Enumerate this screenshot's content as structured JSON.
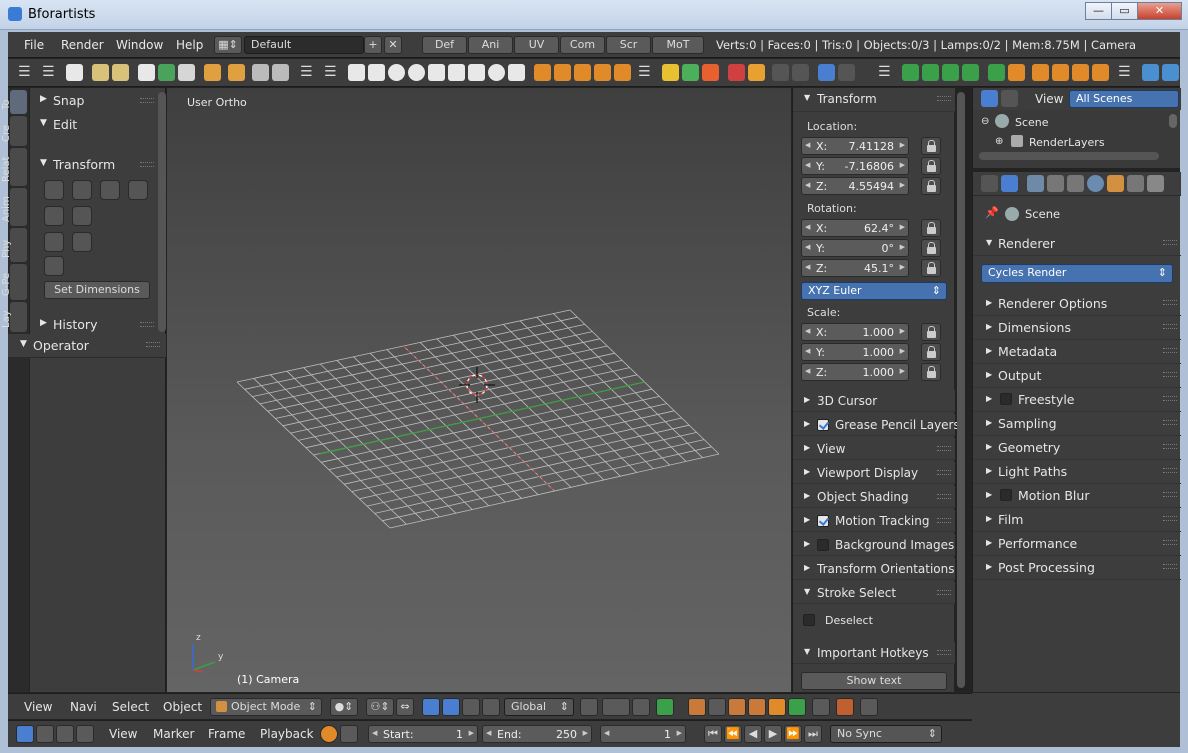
{
  "window": {
    "title": "Bforartists",
    "buttons": [
      "—",
      "▭",
      "✕"
    ]
  },
  "info": {
    "menus": [
      "File",
      "Render",
      "Window",
      "Help"
    ],
    "layout": "Default",
    "screens": [
      "Def",
      "Ani",
      "UV",
      "Com",
      "Scr",
      "MoT"
    ],
    "status": "Verts:0 | Faces:0 | Tris:0 | Objects:0/3 | Lamps:0/2 | Mem:8.75M | Camera"
  },
  "toolshelf": {
    "tabs": [
      "To",
      "Cre",
      "Relat",
      "Anim",
      "Phy",
      "G-Pe",
      "Lay"
    ],
    "panels": {
      "snap": "Snap",
      "edit": "Edit",
      "transform": "Transform",
      "history": "History",
      "operator": "Operator"
    },
    "set_dimensions": "Set Dimensions"
  },
  "viewport": {
    "label": "User Ortho",
    "object": "(1) Camera",
    "axis_x": "y",
    "axis_z": "z"
  },
  "npanel": {
    "transform": "Transform",
    "location_label": "Location:",
    "location": [
      {
        "axis": "X:",
        "value": "7.41128"
      },
      {
        "axis": "Y:",
        "value": "-7.16806"
      },
      {
        "axis": "Z:",
        "value": "4.55494"
      }
    ],
    "rotation_label": "Rotation:",
    "rotation": [
      {
        "axis": "X:",
        "value": "62.4°"
      },
      {
        "axis": "Y:",
        "value": "0°"
      },
      {
        "axis": "Z:",
        "value": "45.1°"
      }
    ],
    "rotation_mode": "XYZ Euler",
    "scale_label": "Scale:",
    "scale": [
      {
        "axis": "X:",
        "value": "1.000"
      },
      {
        "axis": "Y:",
        "value": "1.000"
      },
      {
        "axis": "Z:",
        "value": "1.000"
      }
    ],
    "sections": {
      "cursor": "3D Cursor",
      "grease": "Grease Pencil Layers",
      "view": "View",
      "viewport_display": "Viewport Display",
      "object_shading": "Object Shading",
      "motion_tracking": "Motion Tracking",
      "background_images": "Background Images",
      "transform_orientations": "Transform Orientations",
      "stroke_select": "Stroke Select",
      "deselect": "Deselect",
      "important_hotkeys": "Important Hotkeys",
      "show_text": "Show text"
    }
  },
  "outliner": {
    "view": "View",
    "filter": "All Scenes",
    "scene": "Scene",
    "render_layers": "RenderLayers"
  },
  "properties": {
    "scene": "Scene",
    "renderer_header": "Renderer",
    "engine": "Cycles Render",
    "sections": {
      "renderer_options": "Renderer Options",
      "dimensions": "Dimensions",
      "metadata": "Metadata",
      "output": "Output",
      "freestyle": "Freestyle",
      "sampling": "Sampling",
      "geometry": "Geometry",
      "light_paths": "Light Paths",
      "motion_blur": "Motion Blur",
      "film": "Film",
      "performance": "Performance",
      "post_processing": "Post Processing"
    }
  },
  "vp_header": {
    "menus": [
      "View",
      "Navi",
      "Select",
      "Object"
    ],
    "mode": "Object Mode",
    "orientation": "Global"
  },
  "timeline": {
    "menus": [
      "View",
      "Marker",
      "Frame",
      "Playback"
    ],
    "start_label": "Start:",
    "start": "1",
    "end_label": "End:",
    "end": "250",
    "current": "1",
    "sync": "No Sync"
  }
}
